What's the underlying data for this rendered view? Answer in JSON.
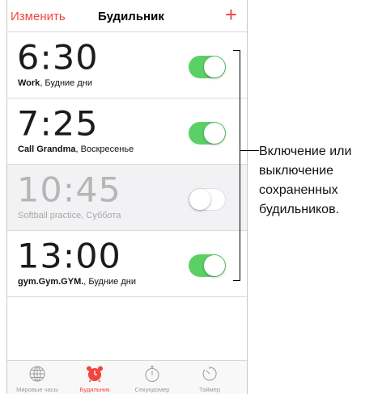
{
  "navbar": {
    "edit_label": "Изменить",
    "title": "Будильник",
    "add_label": "+"
  },
  "alarms": [
    {
      "time": "6:30",
      "name": "Work",
      "repeat": ", Будние дни",
      "enabled": true
    },
    {
      "time": "7:25",
      "name": "Call Grandma",
      "repeat": ", Воскресенье",
      "enabled": true
    },
    {
      "time": "10:45",
      "name": "Softball practice",
      "repeat": ", Суббота",
      "enabled": false
    },
    {
      "time": "13:00",
      "name": "gym.Gym.GYM.",
      "repeat": ", Будние дни",
      "enabled": true
    }
  ],
  "tabs": [
    {
      "label": "Мировые часы",
      "icon": "globe-icon",
      "active": false
    },
    {
      "label": "Будильник",
      "icon": "alarm-clock-icon",
      "active": true
    },
    {
      "label": "Секундомер",
      "icon": "stopwatch-icon",
      "active": false
    },
    {
      "label": "Таймер",
      "icon": "timer-icon",
      "active": false
    }
  ],
  "callout": {
    "lines": [
      "Включение или",
      "выключение",
      "сохраненных",
      "будильников."
    ]
  },
  "colors": {
    "accent": "#f0453d",
    "toggle_on": "#5bd066",
    "disabled_row": "#f2f2f4"
  }
}
